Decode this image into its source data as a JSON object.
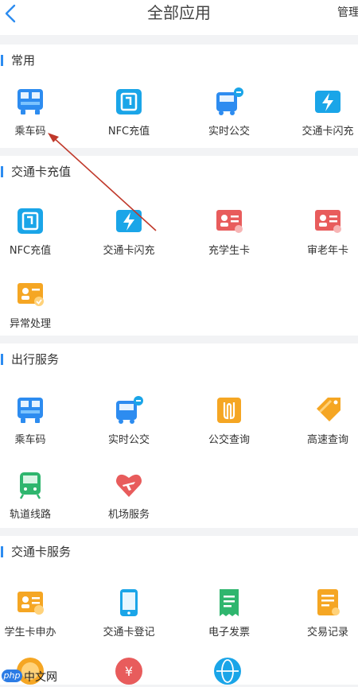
{
  "header": {
    "title": "全部应用",
    "manage": "管理"
  },
  "sections": {
    "common": {
      "title": "常用",
      "items": [
        {
          "label": "乘车码",
          "icon": "bus-code-icon"
        },
        {
          "label": "NFC充值",
          "icon": "nfc-recharge-icon"
        },
        {
          "label": "实时公交",
          "icon": "realtime-bus-icon"
        },
        {
          "label": "交通卡闪充",
          "icon": "flash-charge-icon"
        }
      ]
    },
    "recharge": {
      "title": "交通卡充值",
      "items": [
        {
          "label": "NFC充值",
          "icon": "nfc-recharge-icon"
        },
        {
          "label": "交通卡闪充",
          "icon": "flash-charge-icon"
        },
        {
          "label": "充学生卡",
          "icon": "student-card-icon"
        },
        {
          "label": "审老年卡",
          "icon": "senior-card-icon"
        },
        {
          "label": "异常处理",
          "icon": "exception-icon"
        }
      ]
    },
    "travel": {
      "title": "出行服务",
      "items": [
        {
          "label": "乘车码",
          "icon": "bus-code-icon"
        },
        {
          "label": "实时公交",
          "icon": "realtime-bus-icon"
        },
        {
          "label": "公交查询",
          "icon": "bus-query-icon"
        },
        {
          "label": "高速查询",
          "icon": "highway-tag-icon"
        },
        {
          "label": "轨道线路",
          "icon": "metro-icon"
        },
        {
          "label": "机场服务",
          "icon": "airport-icon"
        }
      ]
    },
    "card": {
      "title": "交通卡服务",
      "items": [
        {
          "label": "学生卡申办",
          "icon": "student-apply-icon"
        },
        {
          "label": "交通卡登记",
          "icon": "card-register-icon"
        },
        {
          "label": "电子发票",
          "icon": "e-invoice-icon"
        },
        {
          "label": "交易记录",
          "icon": "records-icon"
        }
      ]
    }
  },
  "watermark": {
    "logo": "php",
    "text": "中文网"
  },
  "colors": {
    "accent": "#2d8cf0",
    "teal": "#1aa5e8",
    "red": "#e85c5c",
    "orange": "#f5a623",
    "green": "#2fb66e",
    "arrow": "#c0392b"
  }
}
